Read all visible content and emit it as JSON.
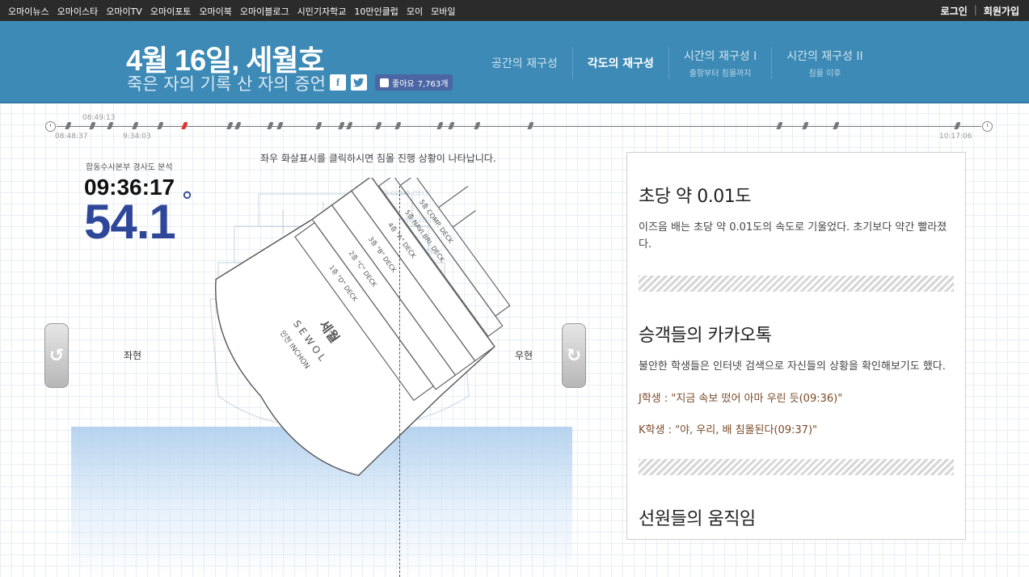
{
  "topbar": {
    "menu": [
      "오마이뉴스",
      "오마이스타",
      "오마이TV",
      "오마이포토",
      "오마이북",
      "오마이블로그",
      "시민기자학교",
      "10만인클럽",
      "모이",
      "모바일"
    ],
    "login": "로그인",
    "separator": "|",
    "signup": "회원가입"
  },
  "header": {
    "title": "4월 16일, 세월호",
    "subtitle": "죽은 자의 기록 산 자의 증언",
    "facebook_icon": "f",
    "twitter_icon": "twitter-bird",
    "like_label": "좋아요",
    "like_count": "7,763개",
    "nav": [
      {
        "label": "공간의 재구성",
        "sub": ""
      },
      {
        "label": "각도의 재구성",
        "sub": ""
      },
      {
        "label": "시간의 재구성 I",
        "sub": "출항부터 침몰까지"
      },
      {
        "label": "시간의 재구성 II",
        "sub": "침몰 이후"
      }
    ]
  },
  "timeline": {
    "start_time": "08:48:37",
    "top_time": "08:49:13",
    "mid_time": "9:34:03",
    "end_time": "10:17:06"
  },
  "main": {
    "agency": "합동수사본부 경사도 분석",
    "time": "09:36:17",
    "angle": "54.1",
    "degree": "°",
    "instruction": "좌우 화살표시를 클릭하시면 침몰 진행 상황이 나타납니다.",
    "port_label": "좌현",
    "starboard_label": "우현",
    "ship_labels": {
      "comp_deck": "5층 COMP. DECK",
      "navi_deck": "5층 NAVI.BRI. DECK",
      "a_deck": "4층 \"A\" DECK",
      "b_deck": "3층 \"B\" DECK",
      "c_deck": "2층 \"C\" DECK",
      "d_deck": "1층 \"D\" DECK",
      "hull_name": "세월",
      "hull_en": "S E W O L",
      "hull_port": "인천 INCHON"
    }
  },
  "panel": {
    "sections": [
      {
        "title": "초당 약 0.01도",
        "text": "이즈음 배는 초당 약 0.01도의 속도로 기울었다. 초기보다 약간 빨라졌다."
      },
      {
        "title": "승객들의 카카오톡",
        "text": "불안한 학생들은 인터넷 검색으로 자신들의 상황을 확인해보기도 했다."
      },
      {
        "title": "선원들의 움직임",
        "text": ""
      }
    ],
    "quotes": [
      "J학생 : \"지금 속보 떴어 아마 우린 듯(09:36)\"",
      "K학생 : \"야, 우리, 배 침몰된다(09:37)\""
    ]
  },
  "colors": {
    "header_bg": "#3c8ab5",
    "angle_text": "#2f4799",
    "timeline_current": "#e53030",
    "quote_text": "#7b4a2a"
  }
}
